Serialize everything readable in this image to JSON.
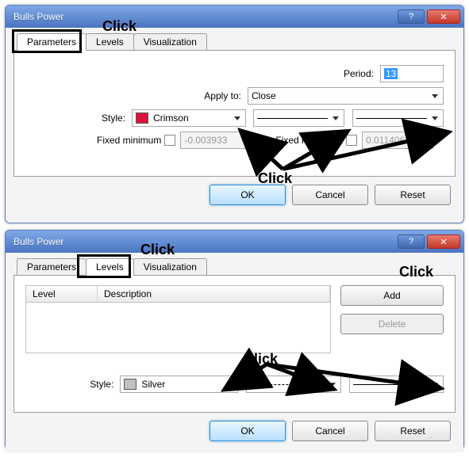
{
  "win1": {
    "title": "Bulls Power",
    "tabs": [
      "Parameters",
      "Levels",
      "Visualization"
    ],
    "active_tab": 0,
    "period_label": "Period:",
    "period_value": "13",
    "applyto_label": "Apply to:",
    "applyto_value": "Close",
    "style_label": "Style:",
    "style_color_name": "Crimson",
    "style_color_hex": "#DC143C",
    "fixed_min_label": "Fixed minimum",
    "fixed_min_value": "-0.003933",
    "fixed_max_label": "Fixed maximum",
    "fixed_max_value": "0.011406",
    "ok": "OK",
    "cancel": "Cancel",
    "reset": "Reset"
  },
  "win2": {
    "title": "Bulls Power",
    "tabs": [
      "Parameters",
      "Levels",
      "Visualization"
    ],
    "active_tab": 1,
    "col_level": "Level",
    "col_desc": "Description",
    "add": "Add",
    "delete": "Delete",
    "style_label": "Style:",
    "style_color_name": "Silver",
    "style_color_hex": "#C0C0C0",
    "ok": "OK",
    "cancel": "Cancel",
    "reset": "Reset"
  },
  "annotations": {
    "click": "Click"
  }
}
